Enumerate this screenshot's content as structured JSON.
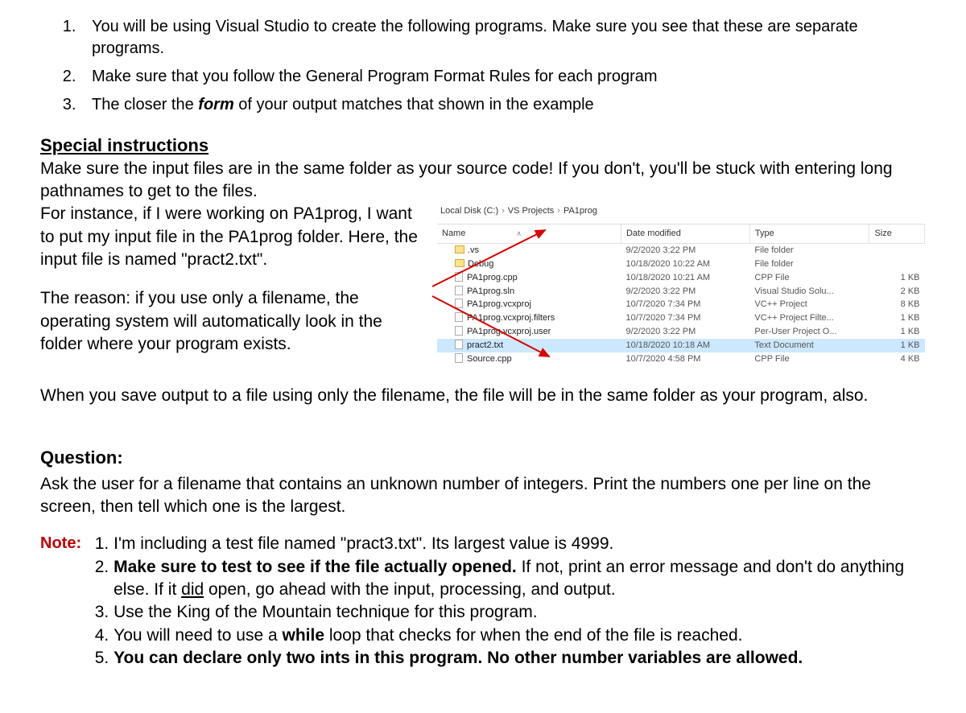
{
  "list1": {
    "item1a": "You will be using Visual Studio to create the following programs. Make sure you see that these are separate programs.",
    "item2": "Make sure that you follow the General Program Format Rules for each program",
    "item3a": "The closer the ",
    "item3b": "form",
    "item3c": " of your output matches that shown in the example"
  },
  "special": {
    "heading": "Special instructions",
    "p1": "Make sure the input files are in the same folder as your source code! If you don't, you'll be stuck with entering long pathnames to get to the files.",
    "p2": "For instance, if I were working on PA1prog, I want to put my input file in the PA1prog folder. Here, the input file is named \"pract2.txt\".",
    "p3": "The reason: if you use only a filename, the operating system will automatically look in the folder where your program exists.",
    "p4": "When you save output to a file using only the filename, the file will be in the same folder as your program, also."
  },
  "breadcrumb": {
    "b1": "Local Disk (C:)",
    "b2": "VS Projects",
    "b3": "PA1prog"
  },
  "headers": {
    "name": "Name",
    "date": "Date modified",
    "type": "Type",
    "size": "Size"
  },
  "files": [
    {
      "icon": "folder",
      "name": ".vs",
      "date": "9/2/2020 3:22 PM",
      "type": "File folder",
      "size": ""
    },
    {
      "icon": "folder",
      "name": "Debug",
      "date": "10/18/2020 10:22 AM",
      "type": "File folder",
      "size": ""
    },
    {
      "icon": "file",
      "name": "PA1prog.cpp",
      "date": "10/18/2020 10:21 AM",
      "type": "CPP File",
      "size": "1 KB"
    },
    {
      "icon": "file",
      "name": "PA1prog.sln",
      "date": "9/2/2020 3:22 PM",
      "type": "Visual Studio Solu...",
      "size": "2 KB"
    },
    {
      "icon": "file",
      "name": "PA1prog.vcxproj",
      "date": "10/7/2020 7:34 PM",
      "type": "VC++ Project",
      "size": "8 KB"
    },
    {
      "icon": "file",
      "name": "PA1prog.vcxproj.filters",
      "date": "10/7/2020 7:34 PM",
      "type": "VC++ Project Filte...",
      "size": "1 KB"
    },
    {
      "icon": "file",
      "name": "PA1prog.vcxproj.user",
      "date": "9/2/2020 3:22 PM",
      "type": "Per-User Project O...",
      "size": "1 KB"
    },
    {
      "icon": "file",
      "name": "pract2.txt",
      "date": "10/18/2020 10:18 AM",
      "type": "Text Document",
      "size": "1 KB",
      "hl": true
    },
    {
      "icon": "file",
      "name": "Source.cpp",
      "date": "10/7/2020 4:58 PM",
      "type": "CPP File",
      "size": "4 KB"
    }
  ],
  "question": {
    "heading": "Question:",
    "body": "Ask the user for a filename that contains an unknown number of integers. Print the numbers one per line on the screen, then tell which one is the largest."
  },
  "note": {
    "label": "Note:",
    "n1": "I'm including a test file named \"pract3.txt\". Its largest value is 4999.",
    "n2a": "Make sure to test to see if the file actually opened.",
    "n2b": " If not, print an error message and don't do anything else. If it ",
    "n2c": "did",
    "n2d": " open, go ahead with the input, processing, and output.",
    "n3": "Use the King of the Mountain technique for this program.",
    "n4a": "You will need to use a ",
    "n4b": "while",
    "n4c": " loop that checks for when the end of the file is reached.",
    "n5": "You can declare only two ints in this program. No other number variables are allowed."
  }
}
